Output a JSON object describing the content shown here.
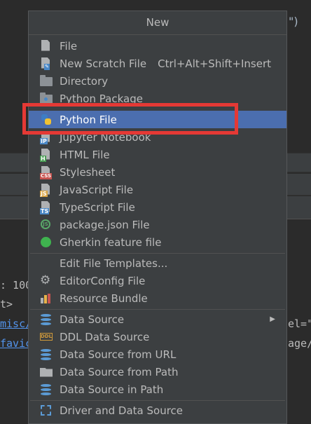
{
  "background": {
    "code_tail": "\")",
    "console_lines": [
      {
        "text": ": 100"
      },
      {
        "text": "t>"
      },
      {
        "left_link": "misc/",
        "right_text": "el=\""
      },
      {
        "left_link": "favic",
        "right_text": "age/"
      }
    ]
  },
  "popup": {
    "title": "New",
    "items": [
      {
        "label": "File",
        "icon": "file-icon"
      },
      {
        "label": "New Scratch File",
        "shortcut": "Ctrl+Alt+Shift+Insert",
        "icon": "scratch-file-icon"
      },
      {
        "label": "Directory",
        "icon": "folder-icon"
      },
      {
        "label": "Python Package",
        "icon": "python-package-icon"
      },
      {
        "label": "Python File",
        "icon": "python-file-icon",
        "selected": true
      },
      {
        "label": "Jupyter Notebook",
        "icon": "jupyter-notebook-icon",
        "badge": "IP"
      },
      {
        "label": "HTML File",
        "icon": "html-file-icon",
        "badge": "H"
      },
      {
        "label": "Stylesheet",
        "icon": "css-file-icon",
        "badge": "CSS"
      },
      {
        "label": "JavaScript File",
        "icon": "javascript-file-icon",
        "badge": "JS"
      },
      {
        "label": "TypeScript File",
        "icon": "typescript-file-icon",
        "badge": "TS"
      },
      {
        "label": "package.json File",
        "icon": "nodejs-icon",
        "badge": "JS"
      },
      {
        "label": "Gherkin feature file",
        "icon": "gherkin-icon"
      },
      {
        "label": "Edit File Templates...",
        "icon": ""
      },
      {
        "label": "EditorConfig File",
        "icon": "gear-icon"
      },
      {
        "label": "Resource Bundle",
        "icon": "resource-bundle-icon"
      },
      {
        "label": "Data Source",
        "icon": "database-icon",
        "submenu": true
      },
      {
        "label": "DDL Data Source",
        "icon": "ddl-icon",
        "badge": "DDL"
      },
      {
        "label": "Data Source from URL",
        "icon": "database-url-icon"
      },
      {
        "label": "Data Source from Path",
        "icon": "folder-open-icon"
      },
      {
        "label": "Data Source in Path",
        "icon": "database-path-icon"
      },
      {
        "label": "Driver and Data Source",
        "icon": "driver-icon"
      }
    ]
  },
  "colors": {
    "selection": "#4b6eaf",
    "highlight_annotation": "#e53935",
    "menu_background": "#3c3f41",
    "python_blue": "#3e7dc4",
    "python_yellow": "#f1c232"
  }
}
